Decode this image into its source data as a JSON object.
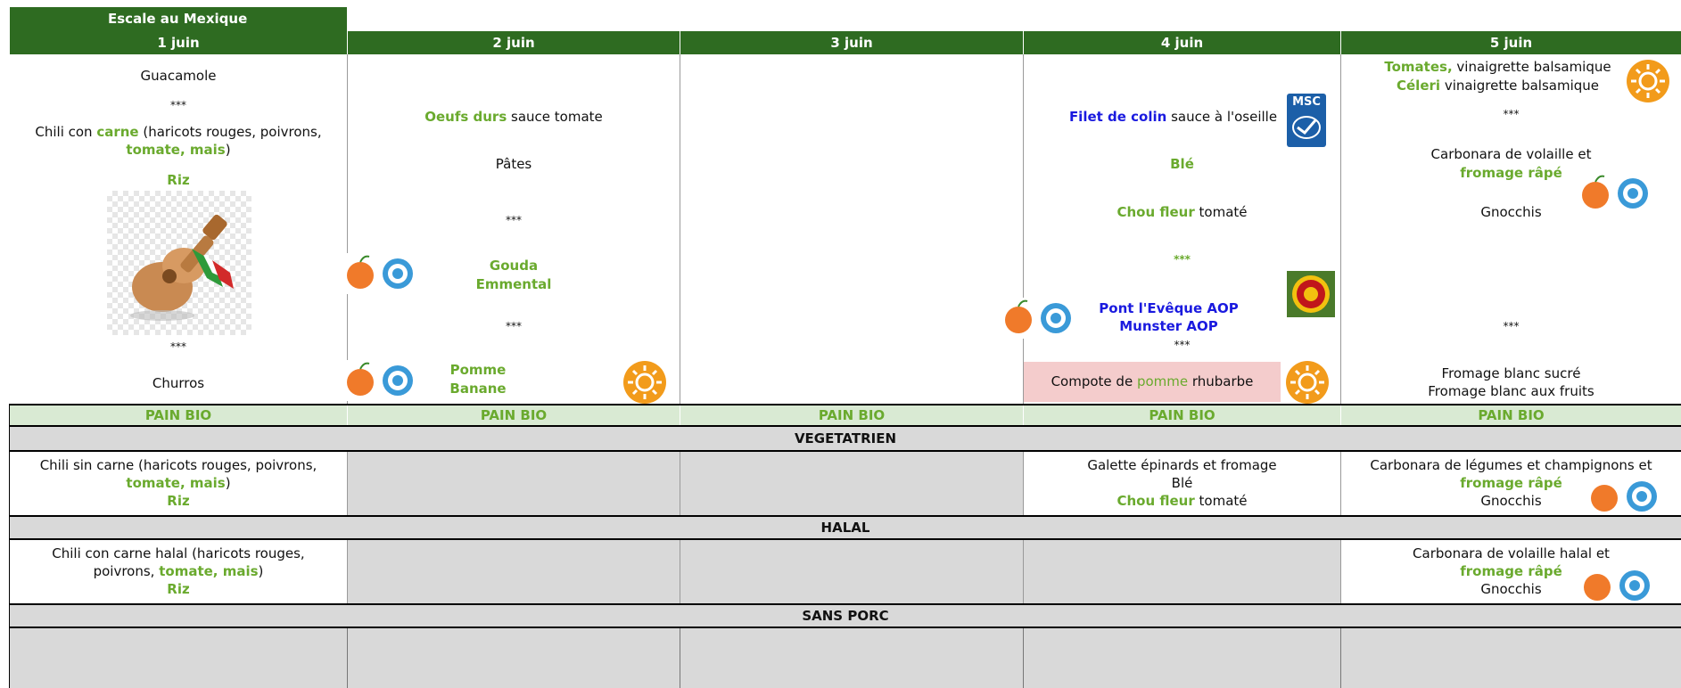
{
  "title": "Escale au Mexique",
  "days": [
    "1 juin",
    "2 juin",
    "3 juin",
    "4 juin",
    "5 juin"
  ],
  "day1": {
    "starter": "Guacamole",
    "sep1": "***",
    "main_a": "Chili con ",
    "main_b": "carne",
    "main_c": " (haricots rouges, poivrons,",
    "main_d": "tomate, mais",
    "main_e": ")",
    "side": "Riz",
    "sep2": "***",
    "dessert": "Churros"
  },
  "day2": {
    "main_a": "Oeufs durs",
    "main_b": " sauce tomate",
    "side": "Pâtes",
    "sep1": "***",
    "cheese1": "Gouda",
    "cheese2": "Emmental",
    "sep2": "***",
    "fruit1": "Pomme",
    "fruit2": "Banane"
  },
  "day4": {
    "main_a": "Filet de colin",
    "main_b": " sauce à l'oseille",
    "side1": "Blé",
    "side2_a": "Chou fleur",
    "side2_b": " tomaté",
    "sep1": "***",
    "cheese1": "Pont l'Evêque AOP",
    "cheese2": "Munster AOP",
    "sep2": "***",
    "dessert_a": "Compote de ",
    "dessert_b": "pomme",
    "dessert_c": " rhubarbe",
    "msc": "MSC"
  },
  "day5": {
    "starter1_a": "Tomates,",
    "starter1_b": " vinaigrette balsamique",
    "starter2_a": "Céleri",
    "starter2_b": " vinaigrette balsamique",
    "sep1": "***",
    "main_a": "Carbonara de volaille et",
    "main_b": "fromage râpé",
    "side": "Gnocchis",
    "sep2": "***",
    "dessert1": "Fromage blanc sucré",
    "dessert2": "Fromage blanc aux fruits"
  },
  "pain": "PAIN BIO",
  "sections": {
    "veg": "VEGETATRIEN",
    "halal": "HALAL",
    "sans_porc": "SANS PORC"
  },
  "veg": {
    "d1_a": "Chili sin carne (haricots rouges, poivrons,",
    "d1_b": "tomate, mais",
    "d1_c": ")",
    "d1_d": "Riz",
    "d4_a": "Galette épinards et fromage",
    "d4_b": "Blé",
    "d4_c": "Chou fleur",
    "d4_d": " tomaté",
    "d5_a": "Carbonara de légumes et champignons et",
    "d5_b": "fromage râpé",
    "d5_c": "Gnocchis"
  },
  "halal": {
    "d1_a": "Chili con carne halal (haricots rouges,",
    "d1_b": "poivrons, ",
    "d1_c": "tomate, mais",
    "d1_d": ")",
    "d1_e": "Riz",
    "d5_a": "Carbonara de volaille halal  et",
    "d5_b": "fromage râpé",
    "d5_c": "Gnocchis"
  },
  "colors": {
    "header_green": "#2e6b21",
    "text_green": "#6aaa2e",
    "text_blue": "#1a1adf",
    "pain_bg": "#d9ead3",
    "gray_bg": "#d9d9d9",
    "pink_bg": "#f4cccc",
    "sun_orange": "#f29b1b"
  },
  "icons": [
    "sun-icon",
    "fruits-lait-ecole-icon",
    "msc-label-icon",
    "aop-label-icon",
    "guitar-illustration",
    "wooden-spoon-icon"
  ]
}
